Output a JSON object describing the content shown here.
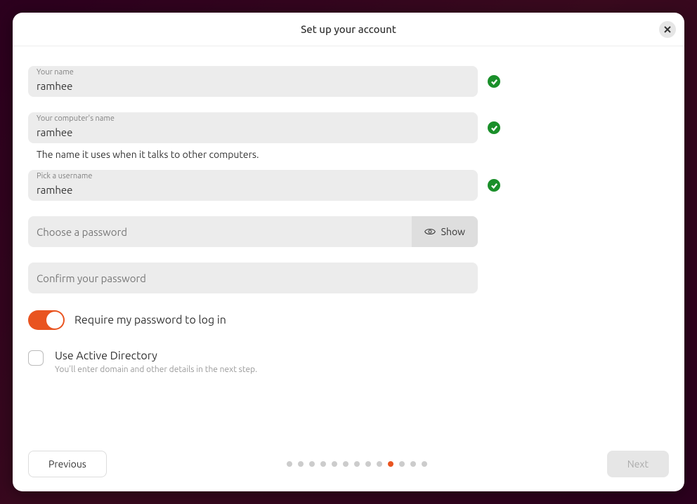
{
  "title": "Set up your account",
  "fields": {
    "name": {
      "label": "Your name",
      "value": "ramhee",
      "valid": true
    },
    "computer": {
      "label": "Your computer's name",
      "value": "ramhee",
      "valid": true,
      "hint": "The name it uses when it talks to other computers."
    },
    "username": {
      "label": "Pick a username",
      "value": "ramhee",
      "valid": true
    },
    "password": {
      "placeholder": "Choose a password",
      "show_label": "Show"
    },
    "confirm": {
      "placeholder": "Confirm your password"
    }
  },
  "toggle": {
    "label": "Require my password to log in",
    "on": true
  },
  "checkbox": {
    "label": "Use Active Directory",
    "hint": "You'll enter domain and other details in the next step.",
    "checked": false
  },
  "nav": {
    "previous": "Previous",
    "next": "Next"
  },
  "progress": {
    "total": 13,
    "current": 10
  }
}
